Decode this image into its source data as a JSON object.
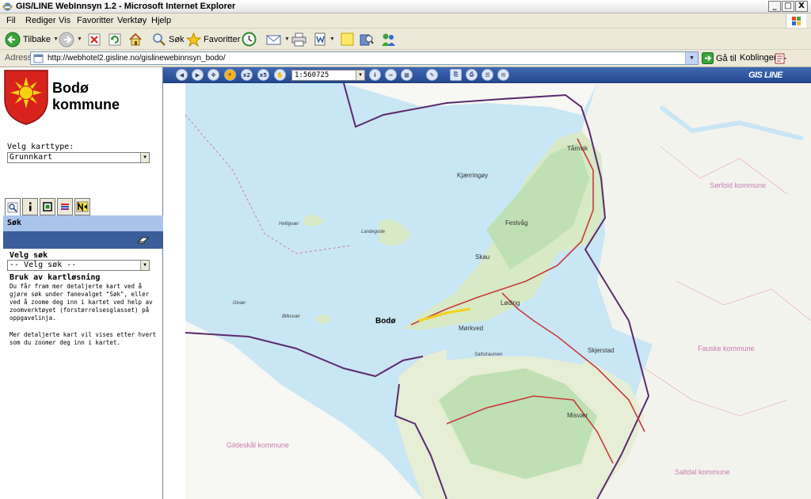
{
  "window": {
    "title": "GIS/LINE WebInnsyn 1.2 - Microsoft Internet Explorer",
    "controls": {
      "minimize": "_",
      "maximize": "□",
      "close": "X"
    }
  },
  "menu": {
    "items": [
      "Fil",
      "Rediger",
      "Vis",
      "Favoritter",
      "Verktøy",
      "Hjelp"
    ]
  },
  "toolbar": {
    "back_label": "Tilbake",
    "search_label": "Søk",
    "favorites_label": "Favoritter"
  },
  "address": {
    "label": "Adresse",
    "url": "http://webhotel2.gisline.no/gislinewebinnsyn_bodo/",
    "go_label": "Gå til",
    "links_label": "Koblinger"
  },
  "left": {
    "logo_line1": "Bodø",
    "logo_line2": "kommune",
    "map_type_label": "Velg karttype:",
    "map_type_value": "Grunnkart",
    "tabs": [
      "search-tab",
      "info-tab",
      "layers-tab",
      "legend-tab",
      "north-tab"
    ],
    "sok_header": "Søk",
    "velg_sok_label": "Velg søk",
    "velg_sok_value": "-- Velg søk --",
    "help_title": "Bruk av kartløsning",
    "help_paragraph1": "Du får fram mer detaljerte kart ved å gjøre søk under fanevalget \"Søk\", eller ved å zoome deg inn i kartet ved help av zoomverktøyet (forstørrelsesglasset) på oppgavelinja.",
    "help_paragraph2": "Mer detaljerte kart vil vises etter hvert som du zoomer deg inn i kartet."
  },
  "map": {
    "scale": "1:560725",
    "brand": "GIS LINE",
    "tool_labels": {
      "zoom_x2": "x2",
      "zoom_x5": "x5"
    },
    "labels": {
      "tarnvik": "Tårnvik",
      "kjaerringoy": "Kjærringøy",
      "festvag": "Festvåg",
      "skau": "Skau",
      "loding": "Løding",
      "bodo": "Bodø",
      "morkved": "Mørkved",
      "saltstraumen": "Saltstraumen",
      "skjerstad": "Skjerstad",
      "misvaer": "Misvær",
      "helligvaer": "Helligvær",
      "landegode": "Landegode",
      "givaer": "Givær",
      "bliksvaer": "Bliksvær",
      "sorfold": "Sørfold kommune",
      "fauske": "Fauske kommune",
      "gildeskal": "Gildeskål kommune",
      "saltdal": "Saltdal kommune"
    }
  },
  "colors": {
    "sea": "#c9e6f5",
    "land": "#f3f3ee",
    "green": "#bfe0b4",
    "border": "#5b2a6e",
    "road": "#c93a3a"
  }
}
